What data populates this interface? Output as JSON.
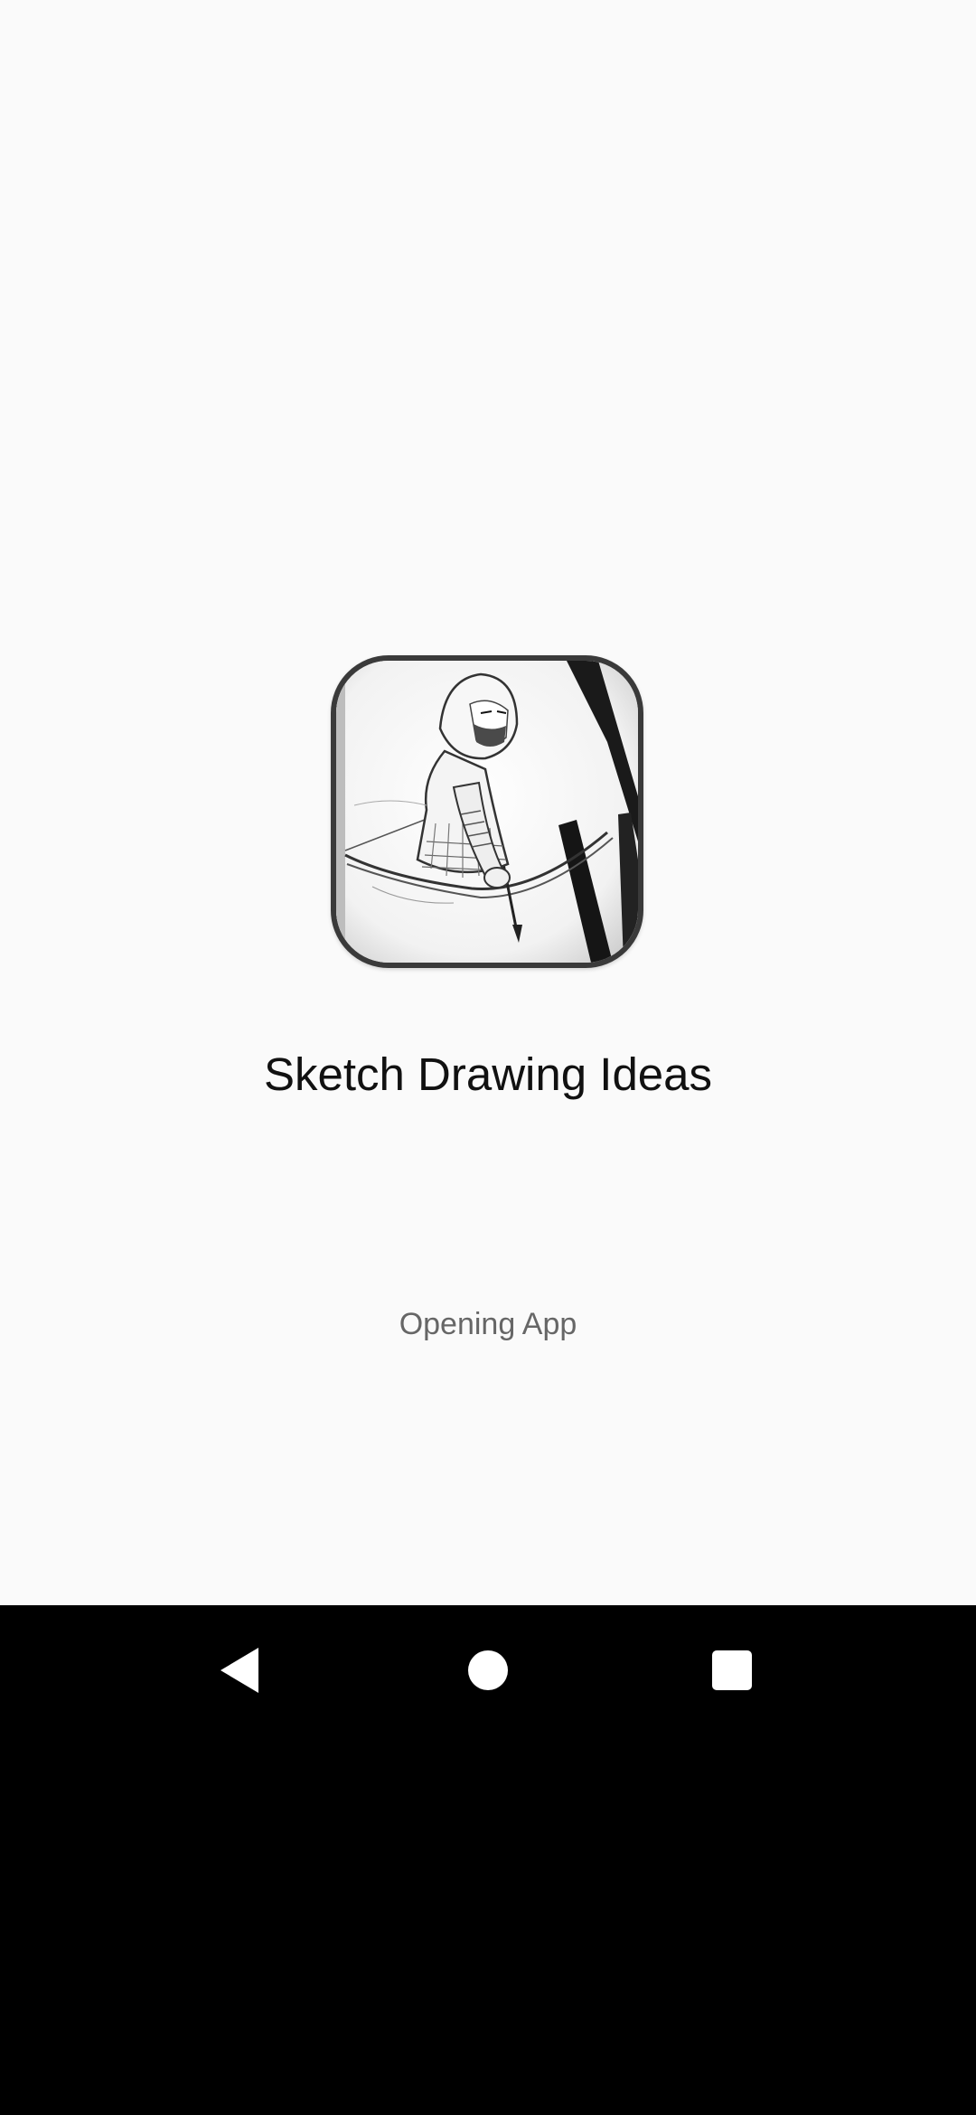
{
  "splash": {
    "app_name": "Sketch Drawing Ideas",
    "status_text": "Opening App",
    "icon": "sketch-archer-app-icon"
  },
  "navigation_bar": {
    "back_icon": "triangle-back-icon",
    "home_icon": "circle-home-icon",
    "recents_icon": "square-recents-icon"
  },
  "colors": {
    "background": "#fafafa",
    "title_text": "#111111",
    "status_text": "#666666",
    "nav_bar": "#000000"
  }
}
